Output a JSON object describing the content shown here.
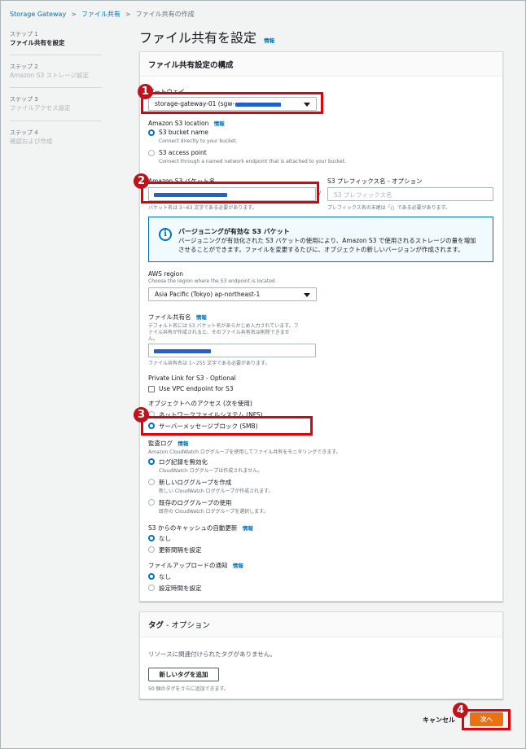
{
  "breadcrumb": {
    "items": [
      "Storage Gateway",
      "ファイル共有"
    ],
    "current": "ファイル共有の作成"
  },
  "steps": [
    {
      "num": "ステップ 1",
      "title": "ファイル共有を設定"
    },
    {
      "num": "ステップ 2",
      "title": "Amazon S3 ストレージ設定"
    },
    {
      "num": "ステップ 3",
      "title": "ファイルアクセス設定"
    },
    {
      "num": "ステップ 4",
      "title": "確認および作成"
    }
  ],
  "page": {
    "title": "ファイル共有を設定",
    "info": "情報"
  },
  "config_panel": {
    "title": "ファイル共有設定の構成",
    "gateway": {
      "label": "ゲートウェイ",
      "value": "storage-gateway-01 (sgw-"
    },
    "s3_location": {
      "label": "Amazon S3 location",
      "info": "情報",
      "options": [
        {
          "label": "S3 bucket name",
          "desc": "Connect directly to your bucket."
        },
        {
          "label": "S3 access point",
          "desc": "Connect through a named network endpoint that is attached to your bucket."
        }
      ]
    },
    "bucket": {
      "label": "Amazon S3 バケット名",
      "hint": "バケット名は 3~63 文字である必要があります。"
    },
    "prefix": {
      "label": "S3 プレフィックス名 - オプション",
      "placeholder": "S3 プレフィックス名",
      "separator": "/",
      "hint": "プレフィックス名の末尾は「/」である必要があります。"
    },
    "alert": {
      "title": "バージョニングが有効な S3 バケット",
      "line1": "バージョニングが有効化された S3 バケットの使用により、Amazon S3 で使用されるストレージの量を増加",
      "line2": "させることができます。ファイルを変更するたびに、オブジェクトの新しいバージョンが作成されます。"
    },
    "region": {
      "label": "AWS region",
      "desc": "Choose the region where the S3 endpoint is located",
      "value": "Asia Pacific (Tokyo) ap-northeast-1"
    },
    "share_name": {
      "label": "ファイル共有名",
      "info": "情報",
      "desc1": "デフォルト名には S3 バケット名があらかじめ入力されています。フ",
      "desc2": "ァイル共有が作成されると、そのファイル共有名は削除できませ",
      "desc3": "ん。",
      "hint": "ファイル共有名は 1~255 文字である必要があります。"
    },
    "private_link": {
      "label": "Private Link for S3 - Optional",
      "checkbox": "Use VPC endpoint for S3"
    },
    "access": {
      "label": "オブジェクトへのアクセス (次を使用)",
      "options": [
        "ネットワークファイルシステム (NFS)",
        "サーバーメッセージブロック (SMB)"
      ]
    },
    "audit": {
      "label": "監査ログ",
      "info": "情報",
      "desc": "Amazon CloudWatch ロググループを使用してファイル共有をモニタリングできます。",
      "options": [
        {
          "label": "ログ記録を無効化",
          "desc": "CloudWatch ロググループは作成されません。"
        },
        {
          "label": "新しいロググループを作成",
          "desc": "新しい CloudWatch ロググループが作成されます。"
        },
        {
          "label": "既存のロググループの使用",
          "desc": "既存の CloudWatch ロググループを選択します。"
        }
      ]
    },
    "cache": {
      "label": "S3 からのキャッシュの自動更新",
      "info": "情報",
      "options": [
        "なし",
        "更新間隔を設定"
      ]
    },
    "upload": {
      "label": "ファイルアップロードの通知",
      "info": "情報",
      "options": [
        "なし",
        "設定時間を設定"
      ]
    }
  },
  "tags_panel": {
    "title": "タグ",
    "title_suffix": " - オプション",
    "empty": "リソースに関連付けられたタグがありません。",
    "add_button": "新しいタグを追加",
    "hint": "50 個のタグをさらに追加できます。"
  },
  "footer": {
    "cancel": "キャンセル",
    "next": "次へ"
  },
  "annotations": [
    "1",
    "2",
    "3",
    "4"
  ],
  "colors": {
    "link": "#0073bb",
    "primary_button": "#ec7211",
    "highlight": "#e3000b",
    "badge": "#c0121b",
    "redaction": "#1f62c8"
  }
}
